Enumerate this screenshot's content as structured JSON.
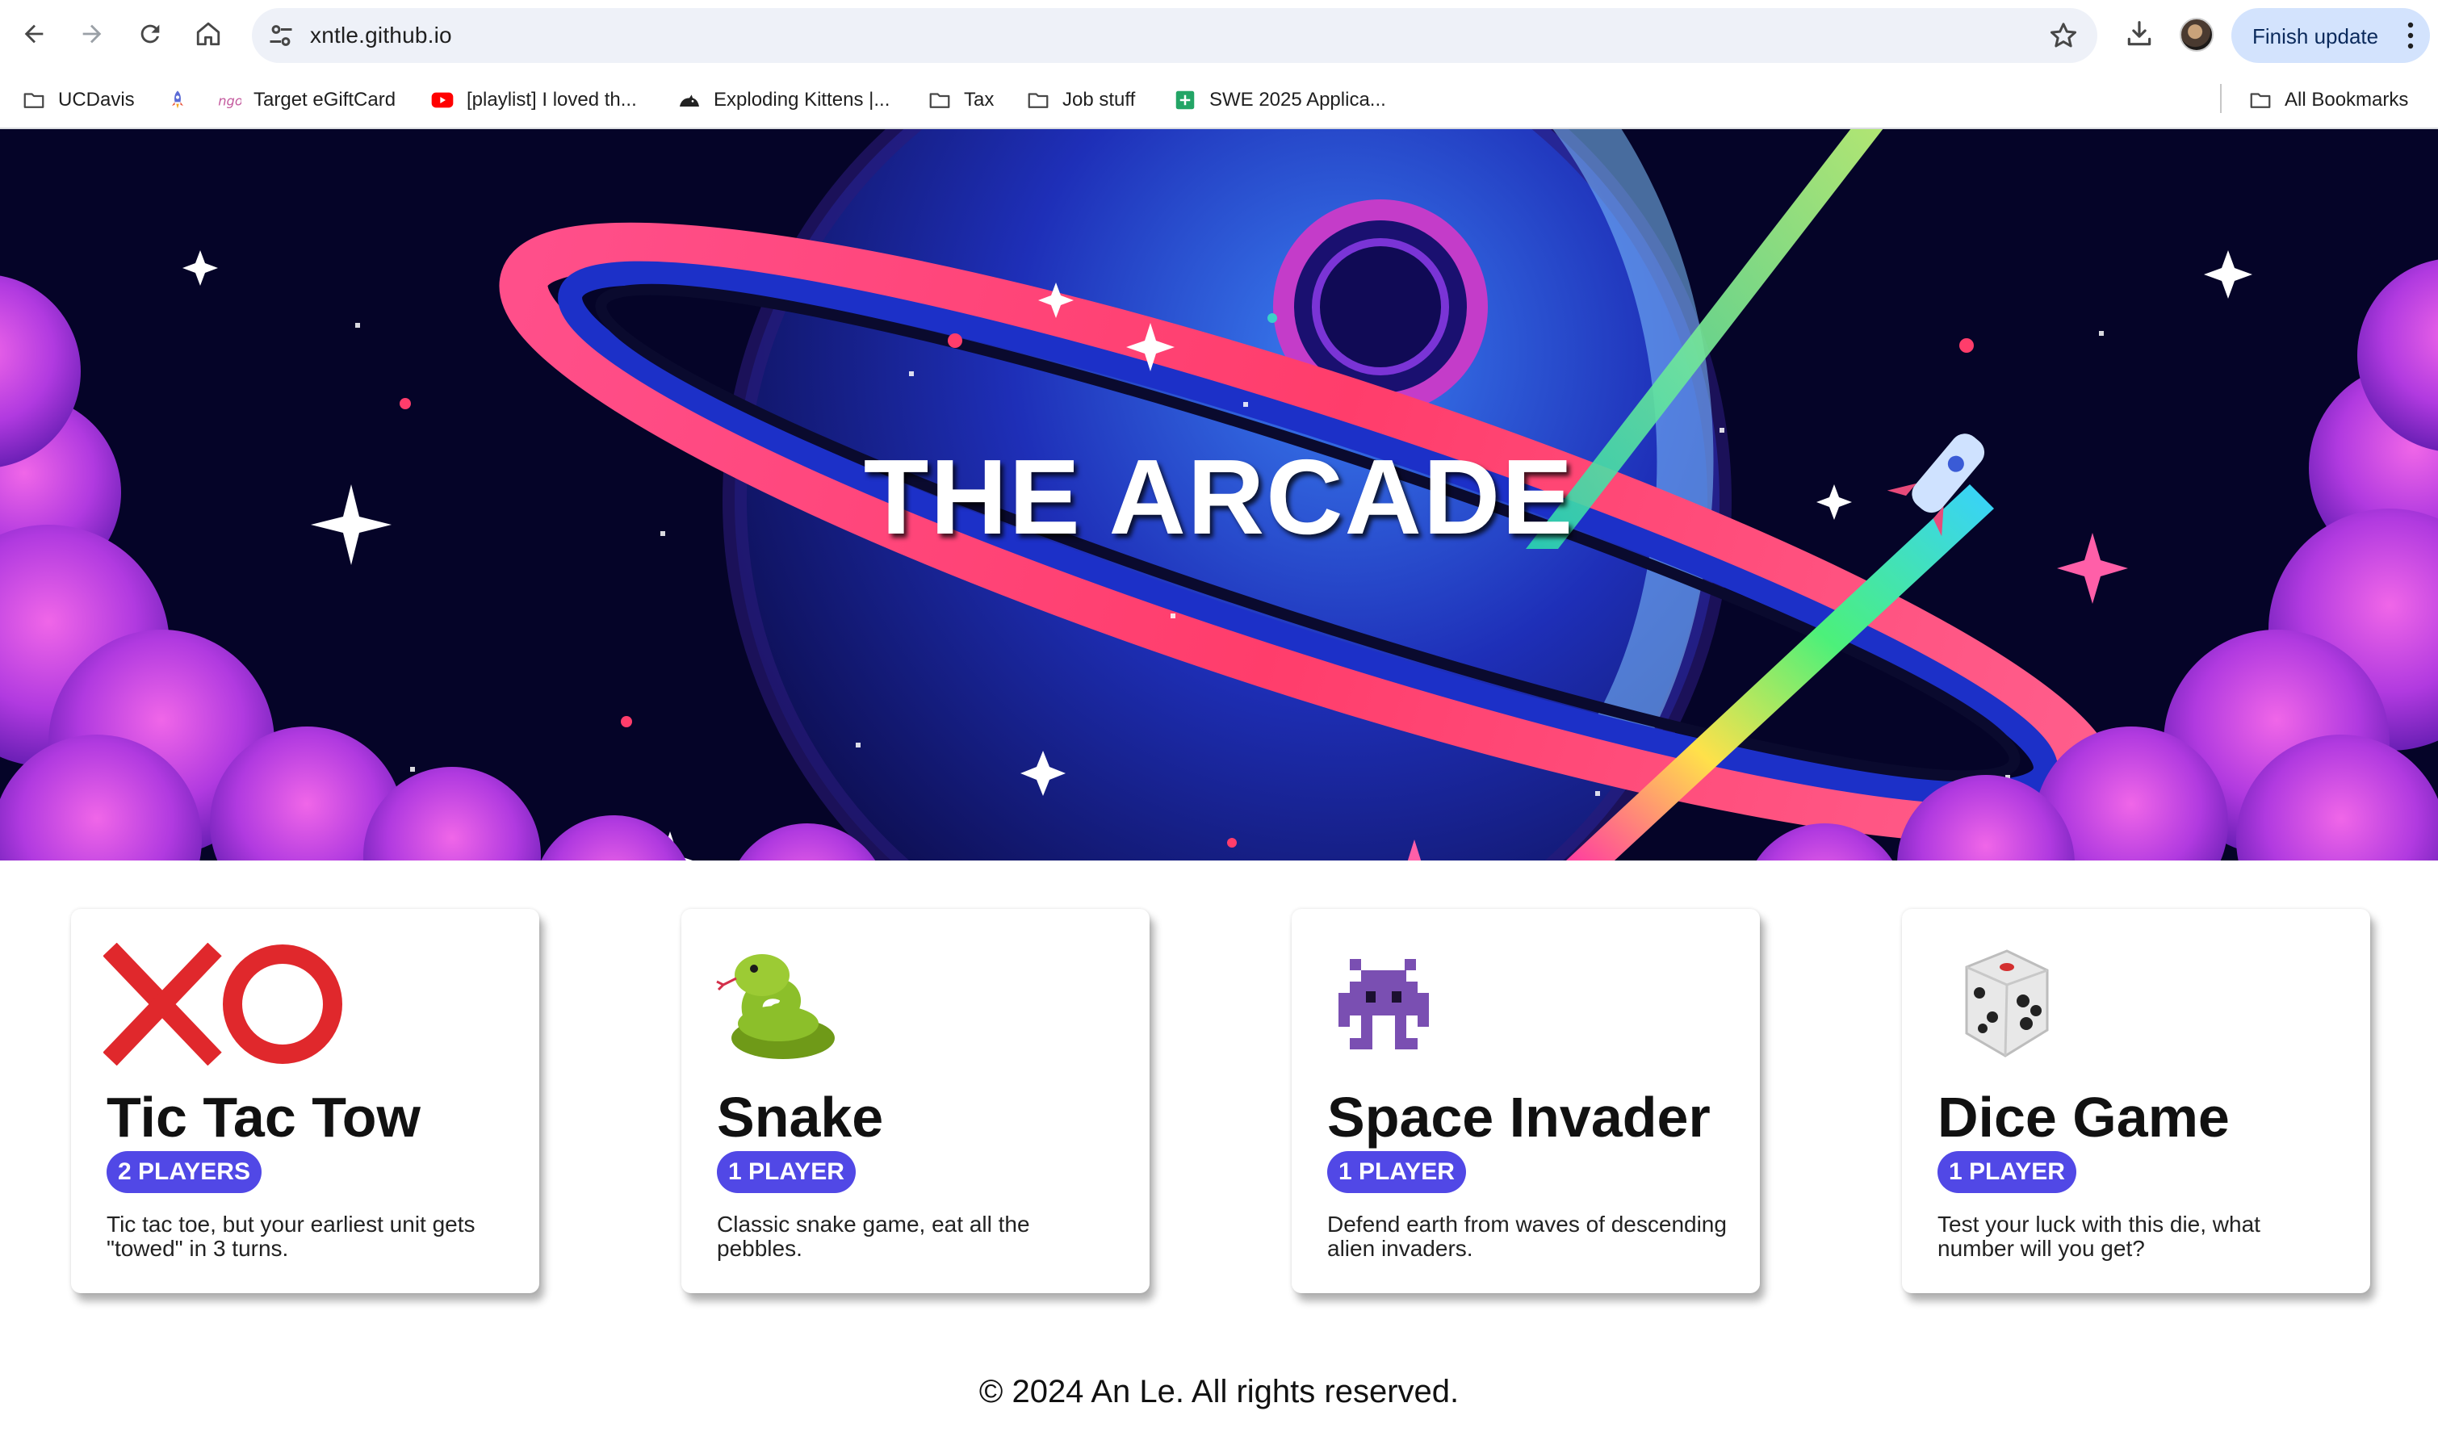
{
  "browser": {
    "url": "xntle.github.io",
    "finish_update_label": "Finish update",
    "bookmarks": [
      {
        "label": "UCDavis",
        "icon": "folder-icon"
      },
      {
        "label": "",
        "icon": "rocket-icon"
      },
      {
        "label": "Target eGiftCard",
        "icon": "target-logo-icon"
      },
      {
        "label": "[playlist] I loved th...",
        "icon": "youtube-icon"
      },
      {
        "label": "Exploding Kittens |...",
        "icon": "kitten-icon"
      },
      {
        "label": "Tax",
        "icon": "folder-icon"
      },
      {
        "label": "Job stuff",
        "icon": "folder-icon"
      },
      {
        "label": "SWE 2025 Applica...",
        "icon": "sheets-icon"
      }
    ],
    "all_bookmarks_label": "All Bookmarks"
  },
  "hero": {
    "title": "THE ARCADE"
  },
  "games": [
    {
      "title": "Tic Tac Tow",
      "players": "2 PLAYERS",
      "description": "Tic tac toe, but your earliest unit gets \"towed\" in 3 turns.",
      "icon": "xo-icon"
    },
    {
      "title": "Snake",
      "players": "1 PLAYER",
      "description": "Classic snake game, eat all the pebbles.",
      "icon": "snake-icon"
    },
    {
      "title": "Space Invader",
      "players": "1 PLAYER",
      "description": "Defend earth from waves of descending alien invaders.",
      "icon": "alien-monster-icon"
    },
    {
      "title": "Dice Game",
      "players": "1 PLAYER",
      "description": "Test your luck with this die, what number will you get?",
      "icon": "dice-icon"
    }
  ],
  "footer": {
    "text": "© 2024 An Le. All rights reserved."
  },
  "colors": {
    "badge": "#5148e6",
    "hero_bg": "#050428",
    "finish_update_bg": "#d3e3fd",
    "omnibox_bg": "#eef1f8"
  }
}
